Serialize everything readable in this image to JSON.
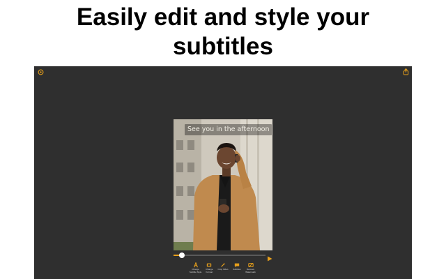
{
  "headline": {
    "line1": "Easily edit and style your",
    "line2": "subtitles"
  },
  "window": {
    "left_button_icon": "settings-icon",
    "right_button_icon": "share-icon"
  },
  "preview": {
    "subtitle_text": "See you in the afternoon"
  },
  "playback": {
    "progress": 0.09,
    "play_icon": "play-icon"
  },
  "toolbar": {
    "tools": [
      {
        "icon": "text-style-icon",
        "label": "Change Subtitle Style"
      },
      {
        "icon": "format-icon",
        "label": "Change Format"
      },
      {
        "icon": "effects-icon",
        "label": "Crop Video"
      },
      {
        "icon": "subtitles-icon",
        "label": "Subtitles"
      },
      {
        "icon": "watermark-icon",
        "label": "Remove Watermark"
      }
    ]
  },
  "colors": {
    "accent": "#e8a01b",
    "window_bg": "#2f2f2f",
    "headline": "#000000"
  }
}
